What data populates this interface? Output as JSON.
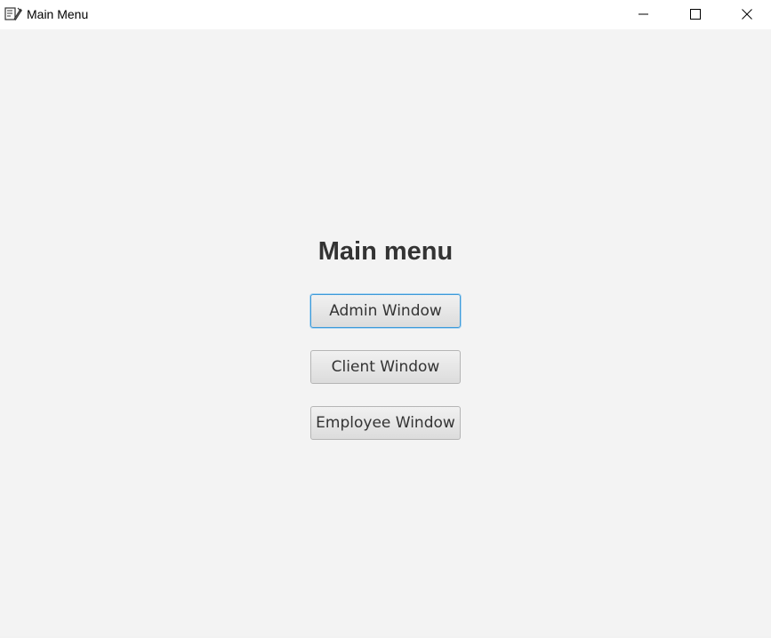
{
  "window": {
    "title": "Main Menu",
    "app_icon": "java-app-icon",
    "controls": [
      "minimize-icon",
      "maximize-icon",
      "close-icon"
    ]
  },
  "main": {
    "heading": "Main menu",
    "buttons": [
      {
        "label": "Admin Window",
        "focused": true
      },
      {
        "label": "Client Window",
        "focused": false
      },
      {
        "label": "Employee Window",
        "focused": false
      }
    ]
  },
  "colors": {
    "background": "#f3f3f3",
    "titlebar": "#ffffff",
    "focus_border": "#3d9ad8",
    "text": "#333333"
  }
}
